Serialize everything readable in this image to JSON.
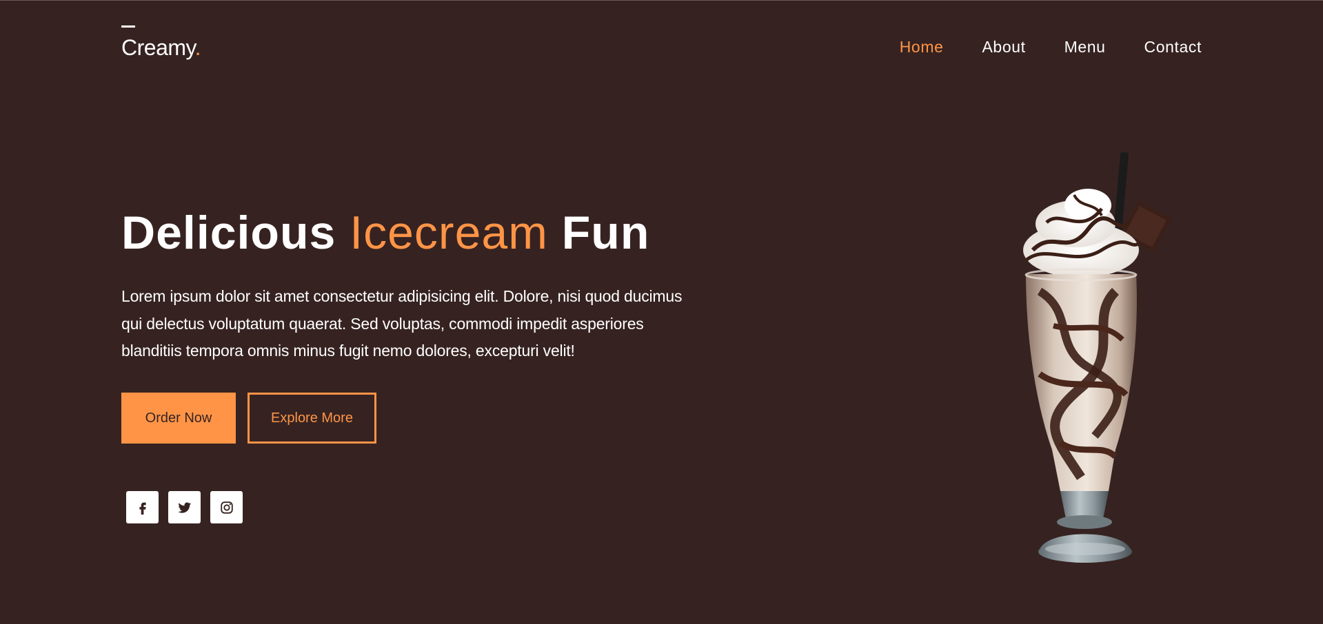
{
  "brand": {
    "name": "Creamy",
    "dot": "."
  },
  "nav": {
    "items": [
      {
        "label": "Home",
        "active": true
      },
      {
        "label": "About",
        "active": false
      },
      {
        "label": "Menu",
        "active": false
      },
      {
        "label": "Contact",
        "active": false
      }
    ]
  },
  "hero": {
    "title_part1": "Delicious ",
    "title_accent": "Icecream",
    "title_part2": " Fun",
    "description": "Lorem ipsum dolor sit amet consectetur adipisicing elit. Dolore, nisi quod ducimus qui delectus voluptatum quaerat. Sed voluptas, commodi impedit asperiores blanditiis tempora omnis minus fugit nemo dolores, excepturi velit!",
    "order_button": "Order Now",
    "explore_button": "Explore More"
  },
  "socials": [
    {
      "icon": "facebook-icon"
    },
    {
      "icon": "twitter-icon"
    },
    {
      "icon": "instagram-icon"
    }
  ],
  "colors": {
    "background": "#362321",
    "accent": "#ff9447",
    "text": "#ffffff"
  }
}
